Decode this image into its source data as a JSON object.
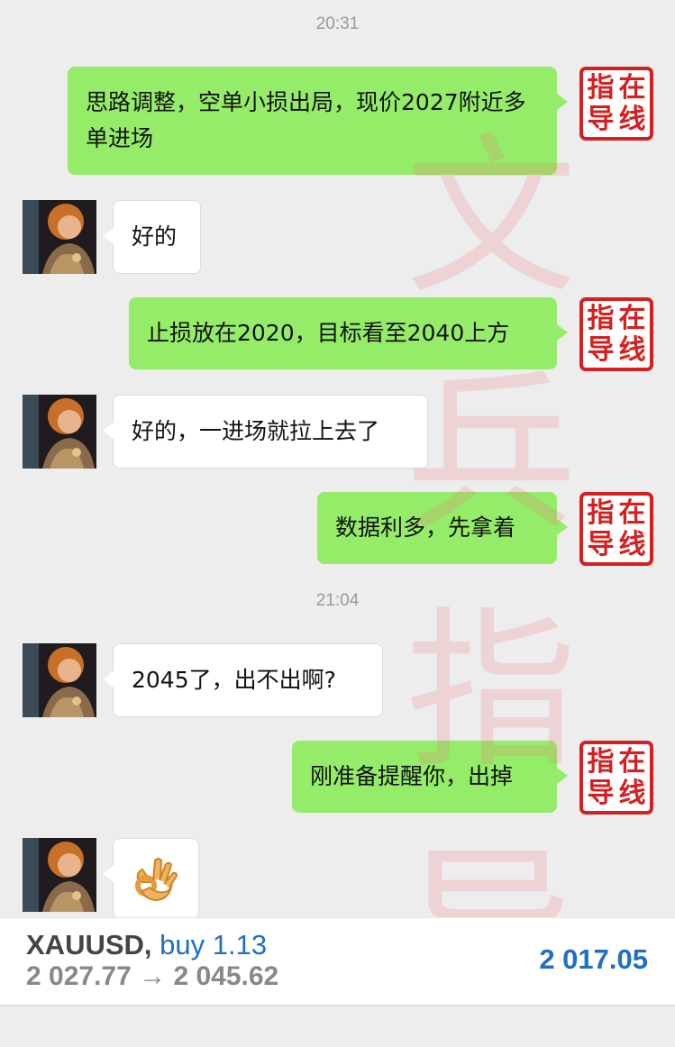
{
  "timestamps": [
    "20:31",
    "21:04"
  ],
  "seal_chars": [
    "指",
    "在",
    "导",
    "线"
  ],
  "messages": [
    {
      "side": "out",
      "text": "思路调整，空单小损出局，现价2027附近多单进场"
    },
    {
      "side": "in",
      "text": "好的"
    },
    {
      "side": "out",
      "text": "止损放在2020，目标看至2040上方"
    },
    {
      "side": "in",
      "text": "好的，一进场就拉上去了"
    },
    {
      "side": "out",
      "text": "数据利多，先拿着"
    },
    {
      "side": "in",
      "text": "2045了，出不出啊?"
    },
    {
      "side": "out",
      "text": "刚准备提醒你，出掉"
    },
    {
      "side": "in",
      "text": "👌",
      "icon": "ok-hand-emoji"
    }
  ],
  "watermark": [
    "文",
    "兵",
    "指",
    "导"
  ],
  "trade": {
    "symbol": "XAUUSD,",
    "side": "buy 1.13",
    "open_price": "2 027.77",
    "arrow": "→",
    "close_price": "2 045.62",
    "profit": "2 017.05",
    "colors": {
      "side": "#1f6fc5",
      "profit": "#1f6fc5"
    }
  },
  "colors": {
    "outgoing_bubble": "#95ec69",
    "incoming_bubble": "#ffffff",
    "background": "#ededed",
    "seal": "#d42020"
  }
}
